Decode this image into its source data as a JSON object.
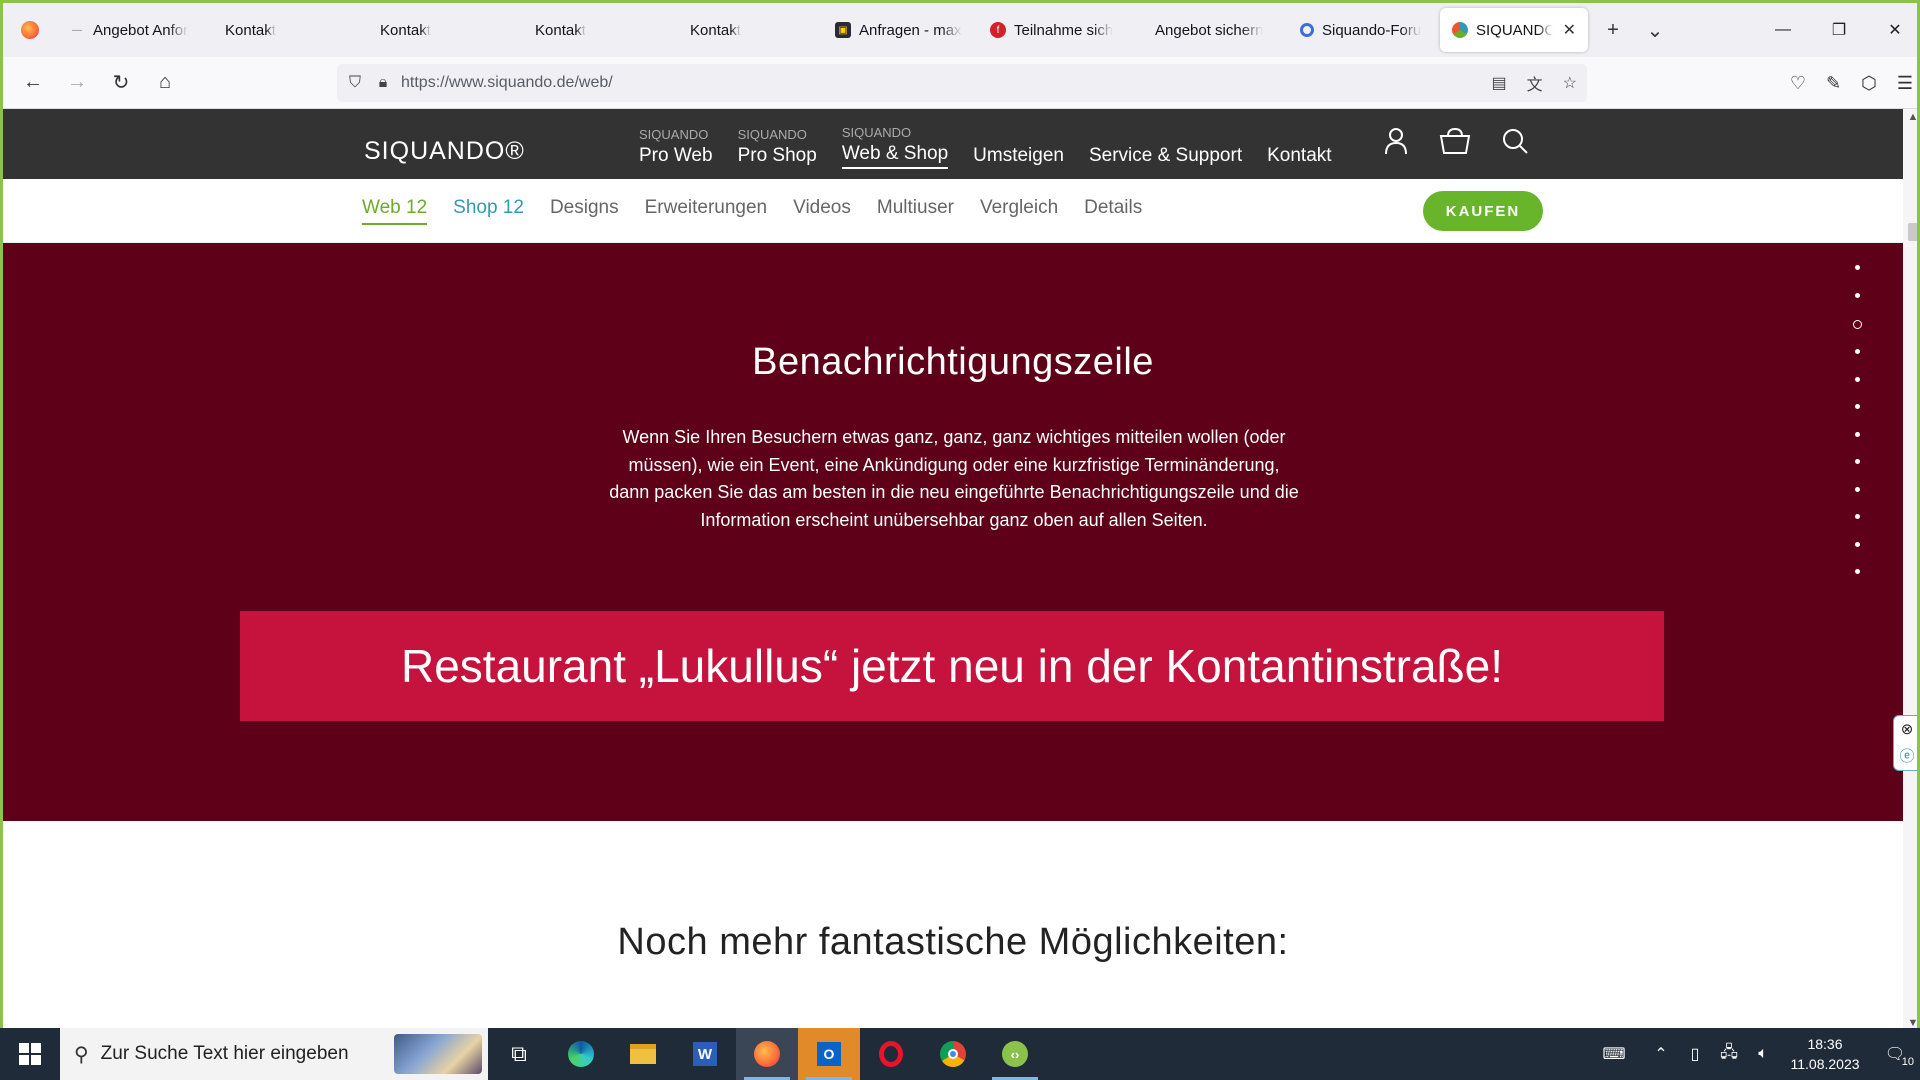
{
  "browser": {
    "tabs": [
      {
        "label": "Angebot Anfor",
        "favicon": "dash-favicon"
      },
      {
        "label": "Kontakt",
        "favicon": ""
      },
      {
        "label": "Kontakt",
        "favicon": ""
      },
      {
        "label": "Kontakt",
        "favicon": ""
      },
      {
        "label": "Kontakt",
        "favicon": ""
      },
      {
        "label": "Anfragen - max",
        "favicon": "dark-square-favicon"
      },
      {
        "label": "Teilnahme sich",
        "favicon": "red-f-favicon"
      },
      {
        "label": "Angebot sichern",
        "favicon": ""
      },
      {
        "label": "Siquando-Foru",
        "favicon": "blue-ring-favicon"
      },
      {
        "label": "SIQUANDO",
        "favicon": "siquando-favicon",
        "active": true
      }
    ],
    "new_tab": "+",
    "tab_list": "⌄",
    "window": {
      "minimize": "—",
      "restore": "❐",
      "close": "✕"
    },
    "url": "https://www.siquando.de/web/"
  },
  "site": {
    "logo": "SIQUANDO®",
    "main_nav": [
      {
        "sup": "SIQUANDO",
        "label": "Pro Web"
      },
      {
        "sup": "SIQUANDO",
        "label": "Pro Shop"
      },
      {
        "sup": "SIQUANDO",
        "label": "Web & Shop",
        "active": true
      },
      {
        "sup": "",
        "label": "Umsteigen"
      },
      {
        "sup": "",
        "label": "Service & Support"
      },
      {
        "sup": "",
        "label": "Kontakt"
      }
    ],
    "sub_nav": [
      "Web 12",
      "Shop 12",
      "Designs",
      "Erweiterungen",
      "Videos",
      "Multiuser",
      "Vergleich",
      "Details"
    ],
    "buy_label": "KAUFEN",
    "hero": {
      "title": "Benachrichtigungszeile",
      "text": "Wenn Sie Ihren Besuchern etwas ganz, ganz, ganz wichtiges mitteilen wollen (oder müssen), wie ein Event, eine Ankündigung oder eine kurzfristige Terminänderung, dann packen Sie das am besten in die neu eingeführte Benachrichtigungszeile und die Information erscheint unübersehbar ganz oben auf allen Seiten.",
      "banner": "Restaurant „Lukullus“ jetzt neu in der Kontantinstraße!"
    },
    "more_title": "Noch mehr fantastische Möglichkeiten:"
  },
  "taskbar": {
    "search_placeholder": "Zur Suche Text hier eingeben",
    "time": "18:36",
    "date": "11.08.2023",
    "notifications": "10"
  }
}
